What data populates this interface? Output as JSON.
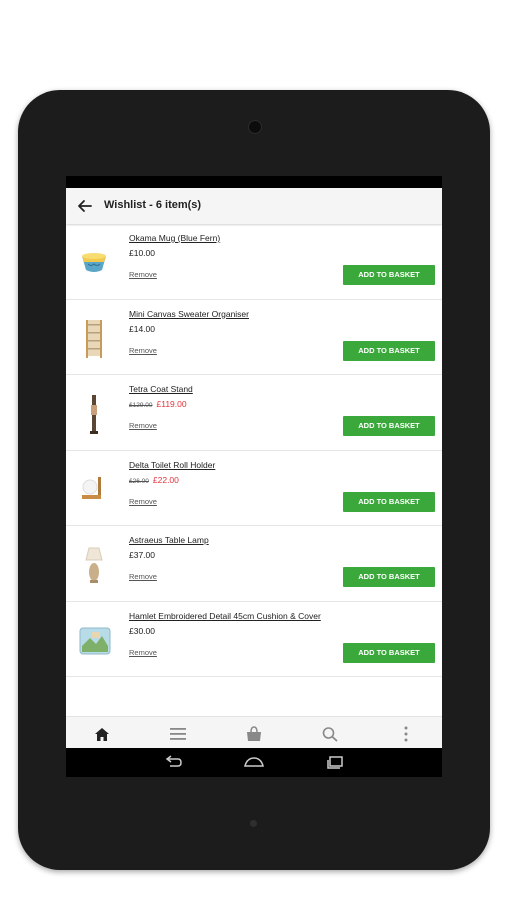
{
  "header": {
    "title": "Wishlist - 6 item(s)"
  },
  "items": [
    {
      "name": "Okama Mug (Blue Fern)",
      "price": "£10.00",
      "was": "",
      "now": "",
      "remove": "Remove",
      "cta": "ADD TO BASKET",
      "thumb_icon": "mug-icon"
    },
    {
      "name": "Mini Canvas Sweater Organiser",
      "price": "£14.00",
      "was": "",
      "now": "",
      "remove": "Remove",
      "cta": "ADD TO BASKET",
      "thumb_icon": "sweater-organiser-icon"
    },
    {
      "name": "Tetra Coat Stand",
      "price": "",
      "was": "£129.00",
      "now": "£119.00",
      "remove": "Remove",
      "cta": "ADD TO BASKET",
      "thumb_icon": "coat-stand-icon"
    },
    {
      "name": "Delta Toilet Roll Holder",
      "price": "",
      "was": "£26.00",
      "now": "£22.00",
      "remove": "Remove",
      "cta": "ADD TO BASKET",
      "thumb_icon": "toilet-roll-holder-icon"
    },
    {
      "name": "Astraeus Table Lamp",
      "price": "£37.00",
      "was": "",
      "now": "",
      "remove": "Remove",
      "cta": "ADD TO BASKET",
      "thumb_icon": "table-lamp-icon"
    },
    {
      "name": "Hamlet Embroidered Detail 45cm Cushion & Cover",
      "price": "£30.00",
      "was": "",
      "now": "",
      "remove": "Remove",
      "cta": "ADD TO BASKET",
      "thumb_icon": "cushion-icon"
    }
  ],
  "bottom_nav": [
    "home-icon",
    "menu-icon",
    "basket-icon",
    "search-icon",
    "more-icon"
  ],
  "system_nav": [
    "back-icon",
    "home-icon",
    "recents-icon"
  ],
  "colors": {
    "accent_green": "#3aa83a",
    "sale_red": "#e5323a"
  }
}
